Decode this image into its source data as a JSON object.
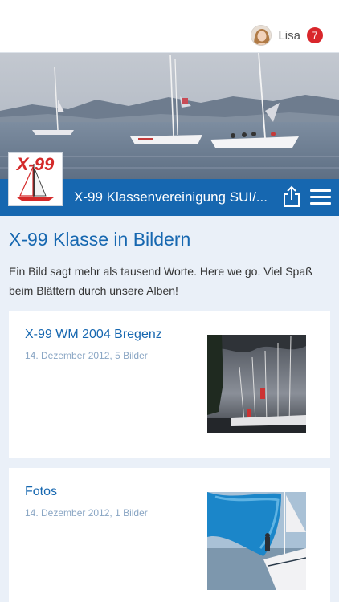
{
  "header": {
    "user_name": "Lisa",
    "notification_count": "7"
  },
  "club": {
    "name": "X-99 Klassenvereinigung SUI/...",
    "logo_text": "X-99"
  },
  "page": {
    "title": "X-99 Klasse in Bildern",
    "intro": "Ein Bild sagt mehr als tausend Worte. Here we go. Viel Spaß beim Blättern durch unsere Alben!"
  },
  "albums": [
    {
      "title": "X-99 WM 2004 Bregenz",
      "meta": "14. Dezember 2012, 5 Bilder"
    },
    {
      "title": "Fotos",
      "meta": "14. Dezember 2012, 1 Bilder"
    }
  ],
  "colors": {
    "brand_blue": "#1667b0",
    "page_background": "#eaf0f8",
    "badge_red": "#d9262b"
  },
  "icons": [
    "user-avatar",
    "share-icon",
    "hamburger-menu-icon"
  ]
}
